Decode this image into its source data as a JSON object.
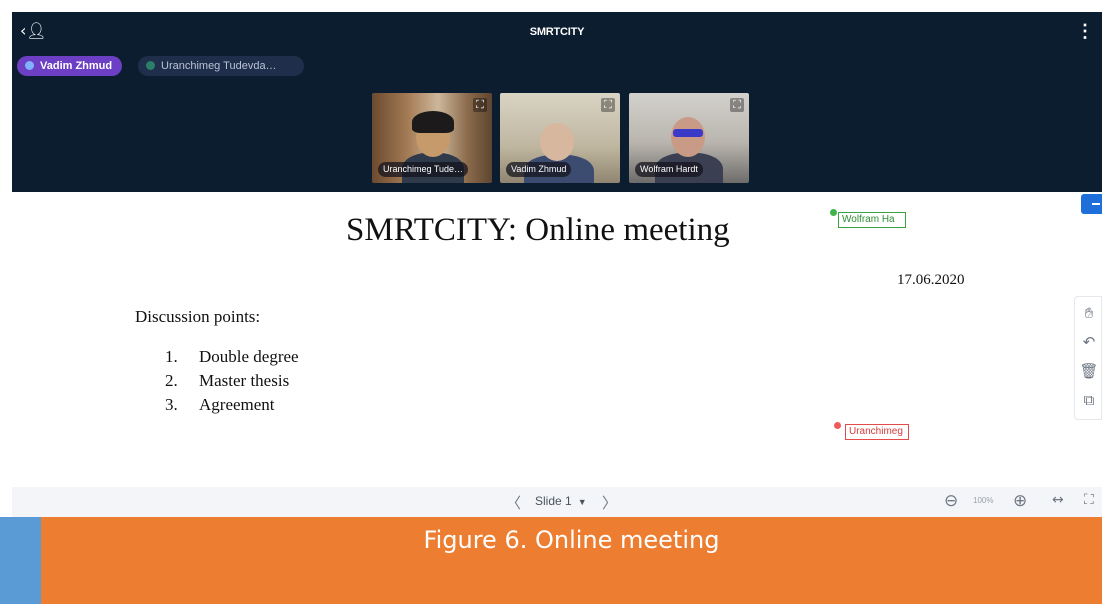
{
  "meeting": {
    "title": "SMRTCITY",
    "back_icon": "user-back-icon",
    "menu_icon": "more-vertical-icon",
    "speaker_label": "Vadim Zhmud",
    "speaker_icon": "microphone-icon",
    "other_participant_label": "Uranchimeg Tudevda…"
  },
  "video_tiles": [
    {
      "name": "Uranchimeg Tude…"
    },
    {
      "name": "Vadim Zhmud"
    },
    {
      "name": "Wolfram Hardt"
    }
  ],
  "slide": {
    "title": "SMRTCITY: Online meeting",
    "date": "17.06.2020",
    "discussion_heading": "Discussion points:",
    "points": [
      {
        "num": "1.",
        "text": "Double degree"
      },
      {
        "num": "2.",
        "text": "Master thesis"
      },
      {
        "num": "3.",
        "text": "Agreement"
      }
    ]
  },
  "cursors": {
    "wolfram": {
      "label": "Wolfram Ha",
      "color": "#3fb44b"
    },
    "uranchimeg": {
      "label": "Uranchimeg",
      "color": "#ef5b5b"
    }
  },
  "tools": [
    "hand-icon",
    "undo-icon",
    "trash-icon",
    "multi-user-whiteboard-icon"
  ],
  "controls": {
    "prev_glyph": "〈",
    "slide_label": "Slide 1",
    "next_glyph": "〉",
    "zoom_level": "100%"
  },
  "caption": "Figure 6. Online meeting",
  "colors": {
    "meeting_bg": "#0c1d30",
    "speaker_pill": "#6c3fc4",
    "caption_band": "#ed7d31",
    "caption_accent": "#5b9bd5"
  }
}
